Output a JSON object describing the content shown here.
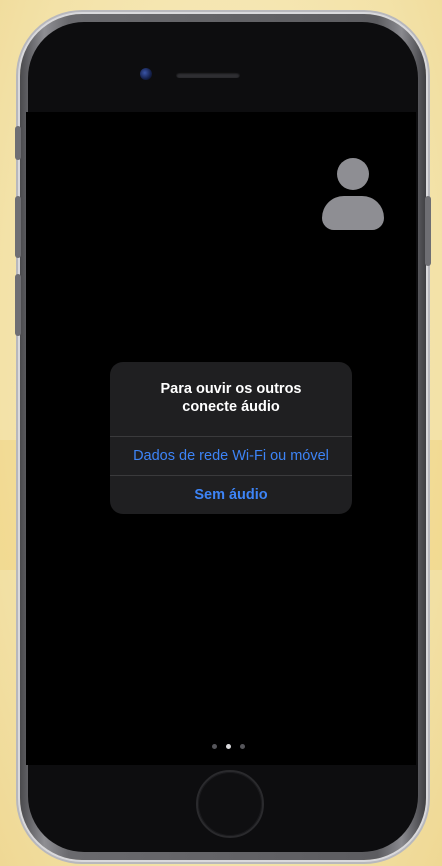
{
  "alert": {
    "title": "Para ouvir os outros\nconecte áudio",
    "actions": [
      {
        "label": "Dados de rede Wi-Fi ou móvel"
      },
      {
        "label": "Sem áudio"
      }
    ]
  },
  "pager": {
    "count": 3,
    "active_index": 1
  },
  "colors": {
    "accent": "#3d84f7",
    "screen_background": "#000000",
    "alert_background": "#1f1f21",
    "avatar": "#8e8e93"
  },
  "icons": {
    "avatar": "person-silhouette-icon",
    "camera": "front-camera-icon",
    "home": "home-button-icon"
  }
}
